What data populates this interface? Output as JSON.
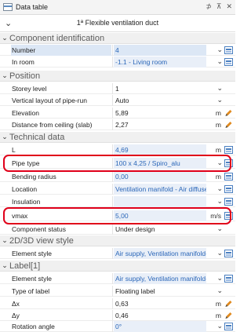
{
  "window": {
    "title": "Data table",
    "controls": [
      "⊅",
      "⊼",
      "✕"
    ]
  },
  "object_name": "1ª Flexible ventilation duct",
  "sections": {
    "component_identification": "Component identification",
    "position": "Position",
    "technical_data": "Technical data",
    "view_style": "2D/3D view style",
    "label": "Label[1]"
  },
  "rows": {
    "number": {
      "label": "Number",
      "value": "4"
    },
    "in_room": {
      "label": "In room",
      "value": "-1.1 - Living room"
    },
    "storey_level": {
      "label": "Storey level",
      "value": "1"
    },
    "vertical_layout": {
      "label": "Vertical layout of pipe-run",
      "value": "Auto"
    },
    "elevation": {
      "label": "Elevation",
      "value": "5,89",
      "unit": "m"
    },
    "distance_ceiling": {
      "label": "Distance from ceiling (slab)",
      "value": "2,27",
      "unit": "m"
    },
    "L": {
      "label": "L",
      "value": "4,69",
      "unit": "m"
    },
    "pipe_type": {
      "label": "Pipe type",
      "value": "100 x 4,25 / Spiro_alu"
    },
    "bending_radius": {
      "label": "Bending radius",
      "value": "0,00",
      "unit": "m"
    },
    "location": {
      "label": "Location",
      "value": "Ventilation manifold - Air diffuser"
    },
    "insulation": {
      "label": "Insulation",
      "value": ""
    },
    "vmax": {
      "label": "vmax",
      "value": "5,00",
      "unit": "m/s"
    },
    "component_status": {
      "label": "Component status",
      "value": "Under design"
    },
    "element_style_view": {
      "label": "Element style",
      "value": "Air supply, Ventilation manifold->"
    },
    "element_style_label": {
      "label": "Element style",
      "value": "Air supply, Ventilation manifold->"
    },
    "type_of_label": {
      "label": "Type of label",
      "value": "Floating label"
    },
    "dx": {
      "label": "Δx",
      "value": "0,63",
      "unit": "m"
    },
    "dy": {
      "label": "Δy",
      "value": "0,46",
      "unit": "m"
    },
    "rotation_angle": {
      "label": "Rotation angle",
      "value": "0°"
    }
  },
  "colors": {
    "accent_blue": "#2a66b8",
    "highlight_red": "#e0001a",
    "pencil_orange": "#e08a1e"
  }
}
